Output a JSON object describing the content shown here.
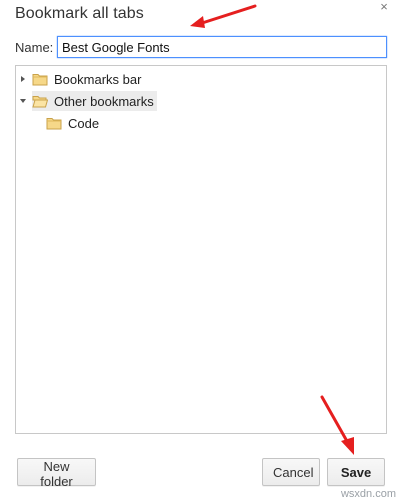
{
  "dialog": {
    "title": "Bookmark all tabs",
    "close_glyph": "×"
  },
  "name_field": {
    "label": "Name:",
    "value": "Best Google Fonts"
  },
  "tree": {
    "items": [
      {
        "label": "Bookmarks bar",
        "expanded": false,
        "icon": "folder-closed-icon"
      },
      {
        "label": "Other bookmarks",
        "expanded": true,
        "selected": true,
        "icon": "folder-open-icon"
      },
      {
        "label": "Code",
        "icon": "folder-closed-icon"
      }
    ]
  },
  "buttons": {
    "new_folder": "New folder",
    "cancel": "Cancel",
    "save": "Save"
  },
  "watermark": "wsxdn.com",
  "colors": {
    "folder_fill": "#f6d889",
    "folder_stroke": "#c9a24a",
    "input_focus": "#4d90fe",
    "annotation_arrow": "#e51f1f"
  }
}
